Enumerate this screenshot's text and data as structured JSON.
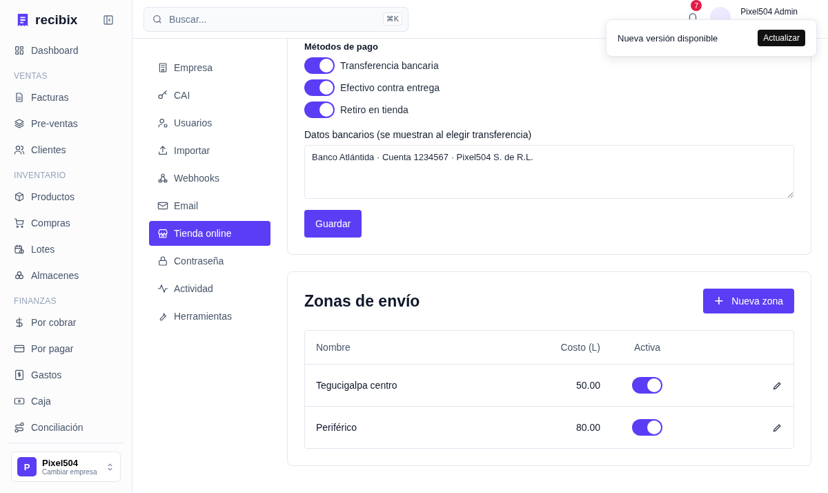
{
  "brand": {
    "name": "recibix"
  },
  "sidebar": {
    "sections": [
      {
        "items": [
          {
            "label": "Dashboard"
          }
        ]
      },
      {
        "heading": "VENTAS",
        "items": [
          {
            "label": "Facturas"
          },
          {
            "label": "Pre-ventas"
          },
          {
            "label": "Clientes"
          }
        ]
      },
      {
        "heading": "INVENTARIO",
        "items": [
          {
            "label": "Productos"
          },
          {
            "label": "Compras"
          },
          {
            "label": "Lotes"
          },
          {
            "label": "Almacenes"
          }
        ]
      },
      {
        "heading": "FINANZAS",
        "items": [
          {
            "label": "Por cobrar"
          },
          {
            "label": "Por pagar"
          },
          {
            "label": "Gastos"
          },
          {
            "label": "Caja"
          },
          {
            "label": "Conciliación"
          }
        ]
      }
    ],
    "company": {
      "initial": "P",
      "name": "Pixel504",
      "subtitle": "Cambiar empresa"
    }
  },
  "search": {
    "placeholder": "Buscar...",
    "shortcut": "⌘K"
  },
  "notifications": {
    "count": "7"
  },
  "user": {
    "name": "Pixel504 Admin"
  },
  "toast": {
    "message": "Nueva versión disponible",
    "action": "Actualizar"
  },
  "settings_nav": [
    {
      "label": "Empresa",
      "selected": false
    },
    {
      "label": "CAI",
      "selected": false
    },
    {
      "label": "Usuarios",
      "selected": false
    },
    {
      "label": "Importar",
      "selected": false
    },
    {
      "label": "Webhooks",
      "selected": false
    },
    {
      "label": "Email",
      "selected": false
    },
    {
      "label": "Tienda online",
      "selected": true
    },
    {
      "label": "Contraseña",
      "selected": false
    },
    {
      "label": "Actividad",
      "selected": false
    },
    {
      "label": "Herramientas",
      "selected": false
    }
  ],
  "payment": {
    "heading": "Métodos de pago",
    "methods": [
      {
        "label": "Transferencia bancaria",
        "on": true
      },
      {
        "label": "Efectivo contra entrega",
        "on": true
      },
      {
        "label": "Retiro en tienda",
        "on": true
      }
    ],
    "bank_label": "Datos bancarios (se muestran al elegir transferencia)",
    "bank_value": "Banco Atlántida · Cuenta 1234567 · Pixel504 S. de R.L.",
    "save": "Guardar"
  },
  "zones": {
    "title": "Zonas de envío",
    "add_icon": "+",
    "add": "Nueva zona",
    "columns": [
      "Nombre",
      "Costo (L)",
      "Activa"
    ],
    "rows": [
      {
        "name": "Tegucigalpa centro",
        "cost": "50.00",
        "active": true
      },
      {
        "name": "Periférico",
        "cost": "80.00",
        "active": true
      }
    ]
  }
}
